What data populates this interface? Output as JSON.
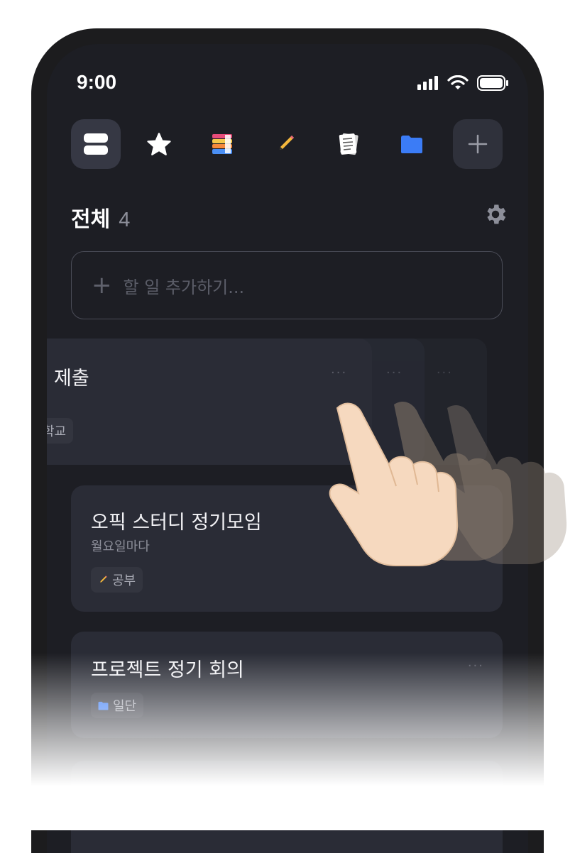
{
  "status": {
    "time": "9:00"
  },
  "tabs": [
    {
      "name": "all",
      "icon": "list-icon",
      "active": true
    },
    {
      "name": "favorites",
      "icon": "star-icon"
    },
    {
      "name": "books",
      "icon": "books-icon"
    },
    {
      "name": "pencil",
      "icon": "pencil-icon"
    },
    {
      "name": "notes",
      "icon": "notes-icon"
    },
    {
      "name": "folder",
      "icon": "folder-icon"
    }
  ],
  "header": {
    "title": "전체",
    "count": "4"
  },
  "add_task": {
    "placeholder": "할 일 추가하기..."
  },
  "tasks": [
    {
      "title": "제출",
      "tag": "학교",
      "swiped": true
    },
    {
      "title": "오픽 스터디 정기모임",
      "subtitle": "월요일마다",
      "tag": "공부",
      "tag_icon": "pencil-icon"
    },
    {
      "title": "프로젝트 정기 회의",
      "tag": "일단",
      "tag_icon": "folder-icon"
    }
  ],
  "colors": {
    "background": "#1d1e24",
    "card": "#2a2c36",
    "accent_folder": "#3b7cf6"
  }
}
